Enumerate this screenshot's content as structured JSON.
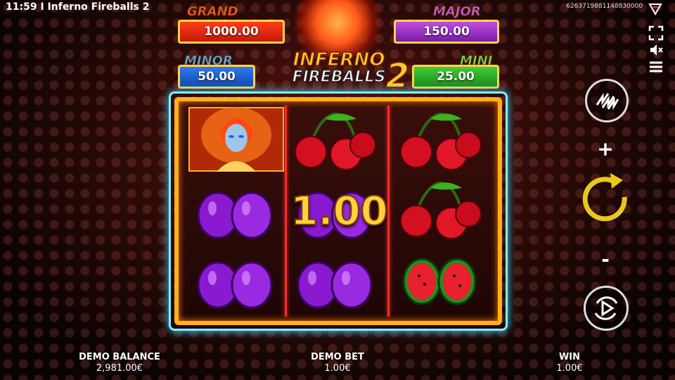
{
  "status_bar": {
    "time": "11:59",
    "separator": "I",
    "title": "Inferno Fireballs 2",
    "session_id": "6263719881148830000"
  },
  "jackpots": {
    "grand": {
      "label": "GRAND",
      "value": "1000.00"
    },
    "major": {
      "label": "MAJOR",
      "value": "150.00"
    },
    "minor": {
      "label": "MINOR",
      "value": "50.00"
    },
    "mini": {
      "label": "MINI",
      "value": "25.00"
    }
  },
  "logo": {
    "line1": "INFERNO",
    "line2": "FIREBALLS",
    "number": "2"
  },
  "reels": [
    [
      "fire-girl",
      "plum",
      "plum"
    ],
    [
      "cherry",
      "plum",
      "plum"
    ],
    [
      "cherry",
      "cherry",
      "watermelon"
    ]
  ],
  "win_overlay": "1.00",
  "controls": {
    "plus": "+",
    "minus": "-"
  },
  "footer": {
    "balance_label": "DEMO BALANCE",
    "balance_value": "2,981.00€",
    "bet_label": "DEMO BET",
    "bet_value": "1.00€",
    "win_label": "WIN",
    "win_value": "1.00€"
  },
  "colors": {
    "accent": "#ffb01a",
    "frame_glow": "#7ff0ff",
    "grand": "#ff3c1a",
    "major": "#a63ad0",
    "minor": "#2d7bf0",
    "mini": "#3fcf3a"
  }
}
